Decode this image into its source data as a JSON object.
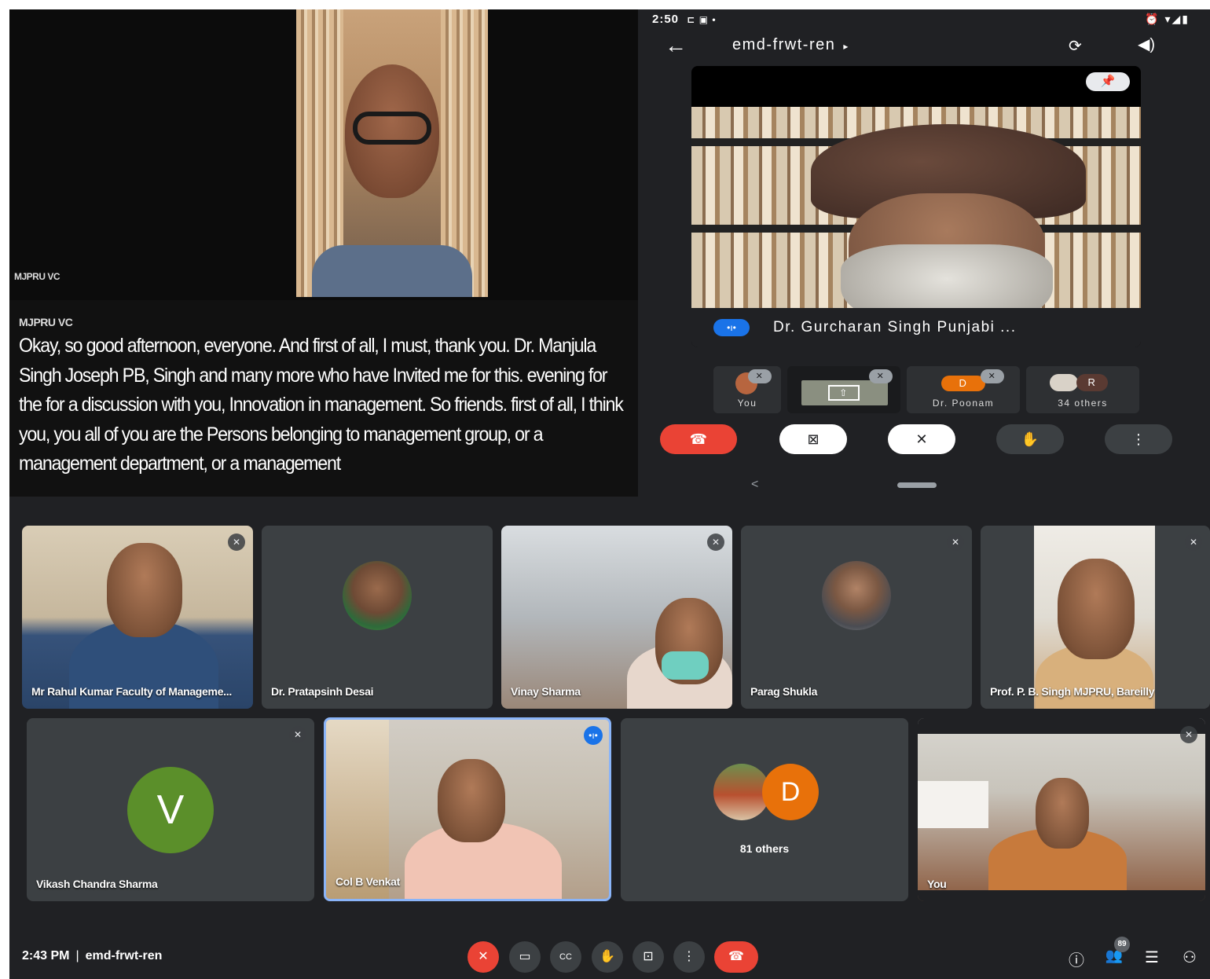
{
  "presentation": {
    "tile_name": "MJPRU VC",
    "caption_speaker": "MJPRU VC",
    "caption_text": "Okay, so good afternoon, everyone. And first of all, I must, thank you. Dr. Manjula Singh Joseph PB, Singh and many more who have Invited me for this. evening for the for a discussion with you, Innovation in management. So friends. first of all, I think you, you all of you are the Persons belonging to management group, or a management department, or a management"
  },
  "phone": {
    "status_time": "2:50",
    "status_icons_left": "⊏ ▣ •",
    "status_icons_right": "⏰ ▾◢▮",
    "back_icon": "←",
    "meeting_code": "emd-frwt-ren",
    "title_caret": "▸",
    "camera_switch_icon": "⟳",
    "speaker_icon": "◀)",
    "pin_icon": "📌",
    "main_speaker": "Dr. Gurcharan Singh Punjabi ...",
    "speaking_icon": "•ı•",
    "thumbs": [
      {
        "label": "You"
      },
      {
        "label": ""
      },
      {
        "label": "Dr. Poonam",
        "initial": "D"
      },
      {
        "label": "34 others",
        "initial": "R"
      }
    ],
    "controls": {
      "end_call": "☎",
      "camera_off": "⊠",
      "mic_off": "✕",
      "raise_hand": "✋",
      "more": "⋮"
    },
    "nav_back": "<"
  },
  "grid": {
    "row1": [
      {
        "name": "Mr Rahul Kumar Faculty of Manageme..."
      },
      {
        "name": "Dr. Pratapsinh Desai"
      },
      {
        "name": "Vinay Sharma"
      },
      {
        "name": "Parag Shukla"
      },
      {
        "name": "Prof. P. B. Singh MJPRU, Bareilly"
      }
    ],
    "row2": [
      {
        "name": "Vikash Chandra Sharma",
        "initial": "V"
      },
      {
        "name": "Col B Venkat"
      },
      {
        "name": "81 others",
        "initial": "D"
      },
      {
        "name": "You"
      }
    ],
    "mute_icon": "✕",
    "speaking_icon": "•ı•"
  },
  "bottombar": {
    "time": "2:43 PM",
    "separator": "|",
    "meeting_code": "emd-frwt-ren",
    "buttons": {
      "mic": "✕",
      "camera": "▭",
      "captions": "CC",
      "raise_hand": "✋",
      "present": "⊡",
      "more": "⋮",
      "leave": "☎"
    },
    "right": {
      "info_icon": "ⓘ",
      "people_icon": "👥",
      "people_count": "89",
      "chat_icon": "☰",
      "activities_icon": "⚇"
    }
  },
  "colors": {
    "meet_dark": "#202124",
    "tile": "#3c4043",
    "accent_blue": "#1a73e8",
    "end_red": "#ea4335",
    "avatar_green": "#5b8f2a",
    "avatar_orange": "#e8710a"
  }
}
